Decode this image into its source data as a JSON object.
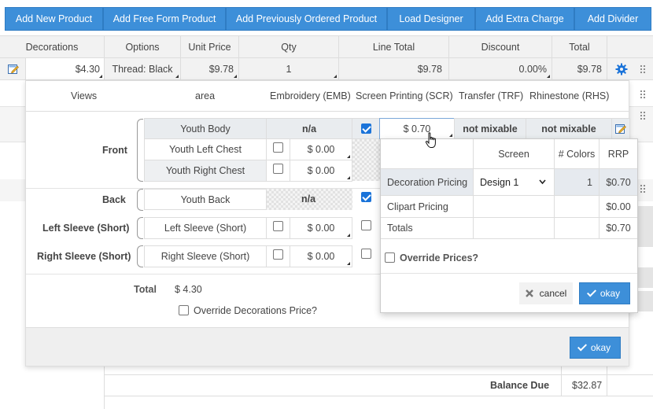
{
  "toolbar": {
    "buttons": [
      "Add New Product",
      "Add Free Form Product",
      "Add Previously Ordered Product",
      "Load Designer",
      "Add Extra Charge",
      "Add Divider"
    ]
  },
  "table": {
    "headers": [
      "Decorations",
      "Options",
      "Unit Price",
      "Qty",
      "Line Total",
      "Discount",
      "Total"
    ],
    "row": {
      "decorations": "$4.30",
      "options": "Thread: Black",
      "unit_price": "$9.78",
      "qty": "1",
      "line_total": "$9.78",
      "discount": "0.00%",
      "total": "$9.78"
    }
  },
  "decorations_panel": {
    "columns": {
      "views": "Views",
      "area": "area",
      "emb": "Embroidery (EMB)",
      "scr": "Screen Printing (SCR)",
      "trf": "Transfer (TRF)",
      "rhs": "Rhinestone (RHS)"
    },
    "views": {
      "front": "Front",
      "back": "Back",
      "left_sleeve": "Left Sleeve (Short)",
      "right_sleeve": "Right Sleeve (Short)"
    },
    "areas": {
      "youth_body": "Youth Body",
      "youth_left_chest": "Youth Left Chest",
      "youth_right_chest": "Youth Right Chest",
      "youth_back": "Youth Back",
      "left_sleeve": "Left Sleeve (Short)",
      "right_sleeve": "Right Sleeve (Short)"
    },
    "na": "n/a",
    "price_zero": "$  0.00",
    "scr_price": "$  0.70",
    "not_mixable": "not mixable",
    "total_label": "Total",
    "total_value": "$ 4.30",
    "override_label": "Override Decorations Price?",
    "okay": "okay"
  },
  "pricing_popup": {
    "headers": [
      "Screen",
      "# Colors",
      "RRP"
    ],
    "rows": [
      {
        "label": "Decoration Pricing",
        "screen": "Design 1",
        "colors": "1",
        "rrp": "$0.70"
      },
      {
        "label": "Clipart Pricing",
        "screen": "",
        "colors": "",
        "rrp": "$0.00"
      },
      {
        "label": "Totals",
        "screen": "",
        "colors": "",
        "rrp": "$0.70"
      }
    ],
    "override_label": "Override Prices?",
    "cancel": "cancel",
    "okay": "okay"
  },
  "summary": {
    "balance_due_label": "Balance Due",
    "balance_due_value": "$32.87"
  },
  "colors": {
    "accent": "#3d8fd9",
    "checkbox_checked": "#1a73d9",
    "header_bg": "#f2f2f2"
  },
  "icons": [
    "edit-icon",
    "gear-icon",
    "drag-handle-icon",
    "cursor-hand-icon",
    "chevron-down-icon",
    "close-icon",
    "check-icon"
  ]
}
